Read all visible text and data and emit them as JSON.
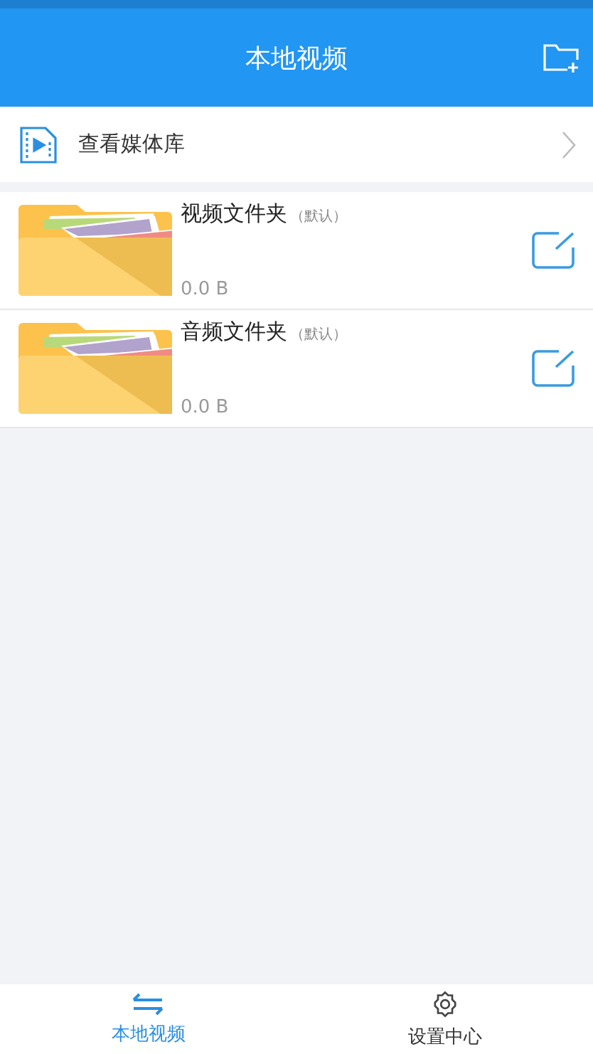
{
  "header": {
    "title": "本地视频"
  },
  "media_library": {
    "label": "查看媒体库"
  },
  "folders": [
    {
      "name": "视频文件夹",
      "tag": "（默认）",
      "size": "0.0 B"
    },
    {
      "name": "音频文件夹",
      "tag": "（默认）",
      "size": "0.0 B"
    }
  ],
  "tabs": [
    {
      "label": "本地视频",
      "kind": "swap",
      "selected": true
    },
    {
      "label": "设置中心",
      "kind": "settings",
      "selected": false
    }
  ]
}
